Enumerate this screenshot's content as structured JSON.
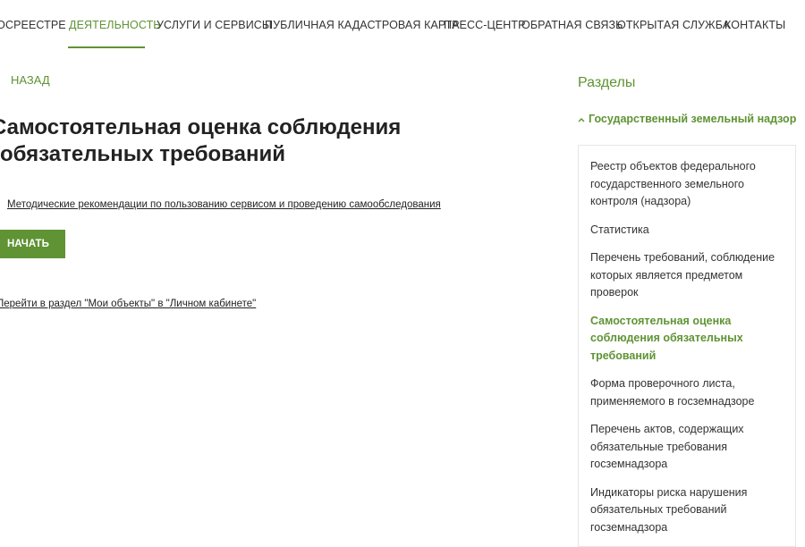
{
  "nav": {
    "items": [
      {
        "label": "РОСРЕЕСТРЕ",
        "active": false
      },
      {
        "label": "ДЕЯТЕЛЬНОСТЬ",
        "active": true
      },
      {
        "label": "УСЛУГИ И СЕРВИСЫ",
        "active": false
      },
      {
        "label": "ПУБЛИЧНАЯ КАДАСТРОВАЯ КАРТА",
        "active": false
      },
      {
        "label": "ПРЕСС-ЦЕНТР",
        "active": false
      },
      {
        "label": "ОБРАТНАЯ СВЯЗЬ",
        "active": false
      },
      {
        "label": "ОТКРЫТАЯ СЛУЖБА",
        "active": false
      },
      {
        "label": "КОНТАКТЫ",
        "active": false
      }
    ]
  },
  "main": {
    "back_label": "НАЗАД",
    "title_line1": "Самостоятельная оценка соблюдения",
    "title_line2": "обязательных требований",
    "doc_link": "Методические рекомендации по пользованию сервисом и проведению самообследования",
    "start_button": "НАЧАТЬ",
    "cabinet_link": "Перейти в раздел \"Мои объекты\" в \"Личном кабинете\""
  },
  "sidebar": {
    "title": "Разделы",
    "section_head": "Государственный земельный надзор",
    "items": [
      {
        "label": "Реестр объектов федерального государственного земельного контроля (надзора)",
        "active": false
      },
      {
        "label": "Статистика",
        "active": false
      },
      {
        "label": "Перечень требований, соблюдение которых является предметом проверок",
        "active": false
      },
      {
        "label": "Самостоятельная оценка соблюдения обязательных требований",
        "active": true
      },
      {
        "label": "Форма проверочного листа, применяемого в госземнадзоре",
        "active": false
      },
      {
        "label": "Перечень актов, содержащих обязательные требования госземнадзора",
        "active": false
      },
      {
        "label": "Индикаторы риска нарушения обязательных требований госземнадзора",
        "active": false
      }
    ]
  },
  "colors": {
    "accent": "#5f9334",
    "text": "#222222"
  }
}
